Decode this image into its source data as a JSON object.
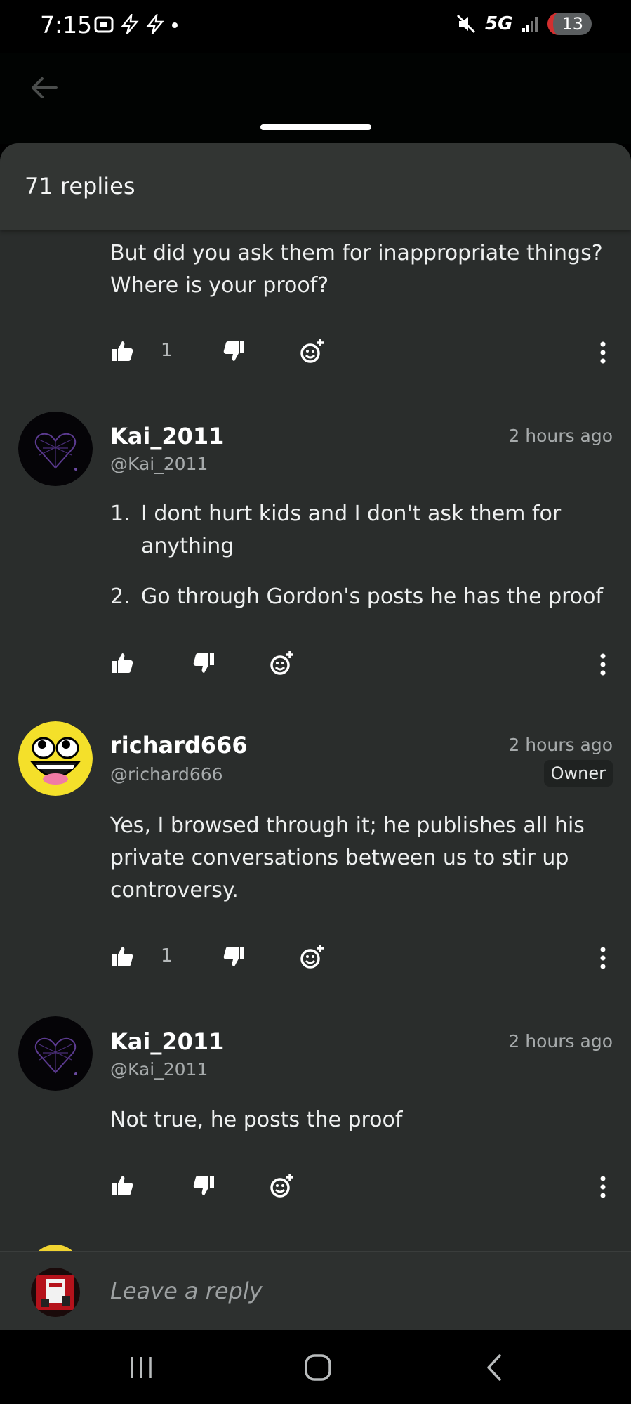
{
  "status_bar": {
    "time": "7:15",
    "network": "5G",
    "battery": "13"
  },
  "sheet": {
    "reply_count": "71 replies"
  },
  "comments": [
    {
      "text_lines": [
        "But did you ask them for inappropriate things?",
        "Where is your proof?"
      ],
      "likes": "1"
    },
    {
      "username": "Kai_2011",
      "handle": "@Kai_2011",
      "time": "2 hours ago",
      "list": [
        {
          "num": "1.",
          "line1": "I dont hurt kids and I don't ask them for",
          "line2": "anything"
        },
        {
          "num": "2.",
          "line1": "Go through Gordon's posts he has the proof"
        }
      ]
    },
    {
      "username": "richard666",
      "handle": "@richard666",
      "time": "2 hours ago",
      "badge": "Owner",
      "text_lines": [
        "Yes, I browsed through it; he publishes all his",
        "private conversations between us to stir up",
        "controversy."
      ],
      "likes": "1"
    },
    {
      "username": "Kai_2011",
      "handle": "@Kai_2011",
      "time": "2 hours ago",
      "text_lines": [
        "Not true, he posts the proof"
      ]
    }
  ],
  "reply_bar": {
    "placeholder": "Leave a reply"
  },
  "colors": {
    "sheet_bg": "#2a2d2c",
    "header_bg": "#323533",
    "accent_avatar_yellow": "#f1d431"
  }
}
